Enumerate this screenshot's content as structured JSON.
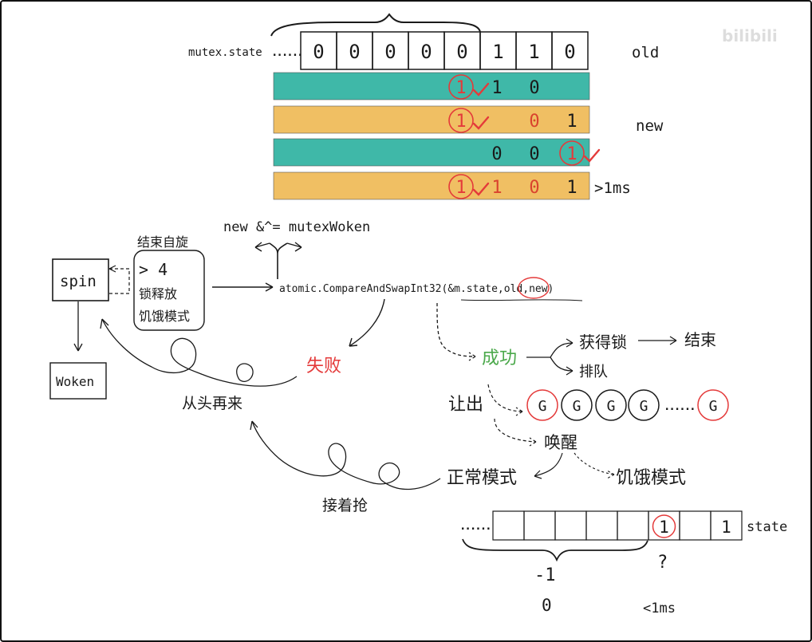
{
  "colors": {
    "teal": "#3fb8a8",
    "orange": "#f0bf63",
    "red": "#e43a3a",
    "green": "#4aa84a",
    "ink": "#1a1a1a"
  },
  "watermark": "bilibili",
  "top": {
    "label": "mutex.state",
    "dots": "......",
    "bits": [
      "0",
      "0",
      "0",
      "0",
      "0",
      "1",
      "1",
      "0"
    ],
    "old_label": "old",
    "new_label": "new",
    "gt1ms_label": ">1ms",
    "rows": [
      {
        "color": "teal",
        "cells": [
          "1",
          "1",
          "0",
          ""
        ],
        "circled": [
          0
        ]
      },
      {
        "color": "orange",
        "cells": [
          "1",
          "",
          "0",
          "1"
        ],
        "circled": [
          0
        ]
      },
      {
        "color": "teal",
        "cells": [
          "",
          "0",
          "0",
          "1"
        ],
        "circled": [
          3
        ]
      },
      {
        "color": "orange",
        "cells": [
          "1",
          "1",
          "0",
          "1"
        ],
        "circled": [
          0
        ]
      }
    ]
  },
  "flow": {
    "spin": "spin",
    "woken": "Woken",
    "end_spin_label": "结束自旋",
    "cond_gt4": "> 4",
    "cond_release": "锁释放",
    "cond_starve": "饥饿模式",
    "new_xor": "new &^= mutexWoken",
    "cas_call": "atomic.CompareAndSwapInt32(&m.state,old,new)",
    "fail": "失败",
    "restart": "从头再来",
    "success": "成功",
    "get_lock": "获得锁",
    "arrow_end": "结束",
    "queue": "排队",
    "yield": "让出",
    "goroutines": [
      "G",
      "G",
      "G",
      "G",
      "G"
    ],
    "goroutine_dots": "......",
    "wake": "唤醒",
    "normal_mode": "正常模式",
    "starve_mode": "饥饿模式",
    "keep_grab": "接着抢"
  },
  "bottom": {
    "dots": "......",
    "cells": [
      "",
      "",
      "",
      "",
      "",
      "1",
      "",
      "1"
    ],
    "state_label": "state",
    "minus_one": "-1",
    "question": "?",
    "zero": "0",
    "lt1ms": "<1ms"
  }
}
